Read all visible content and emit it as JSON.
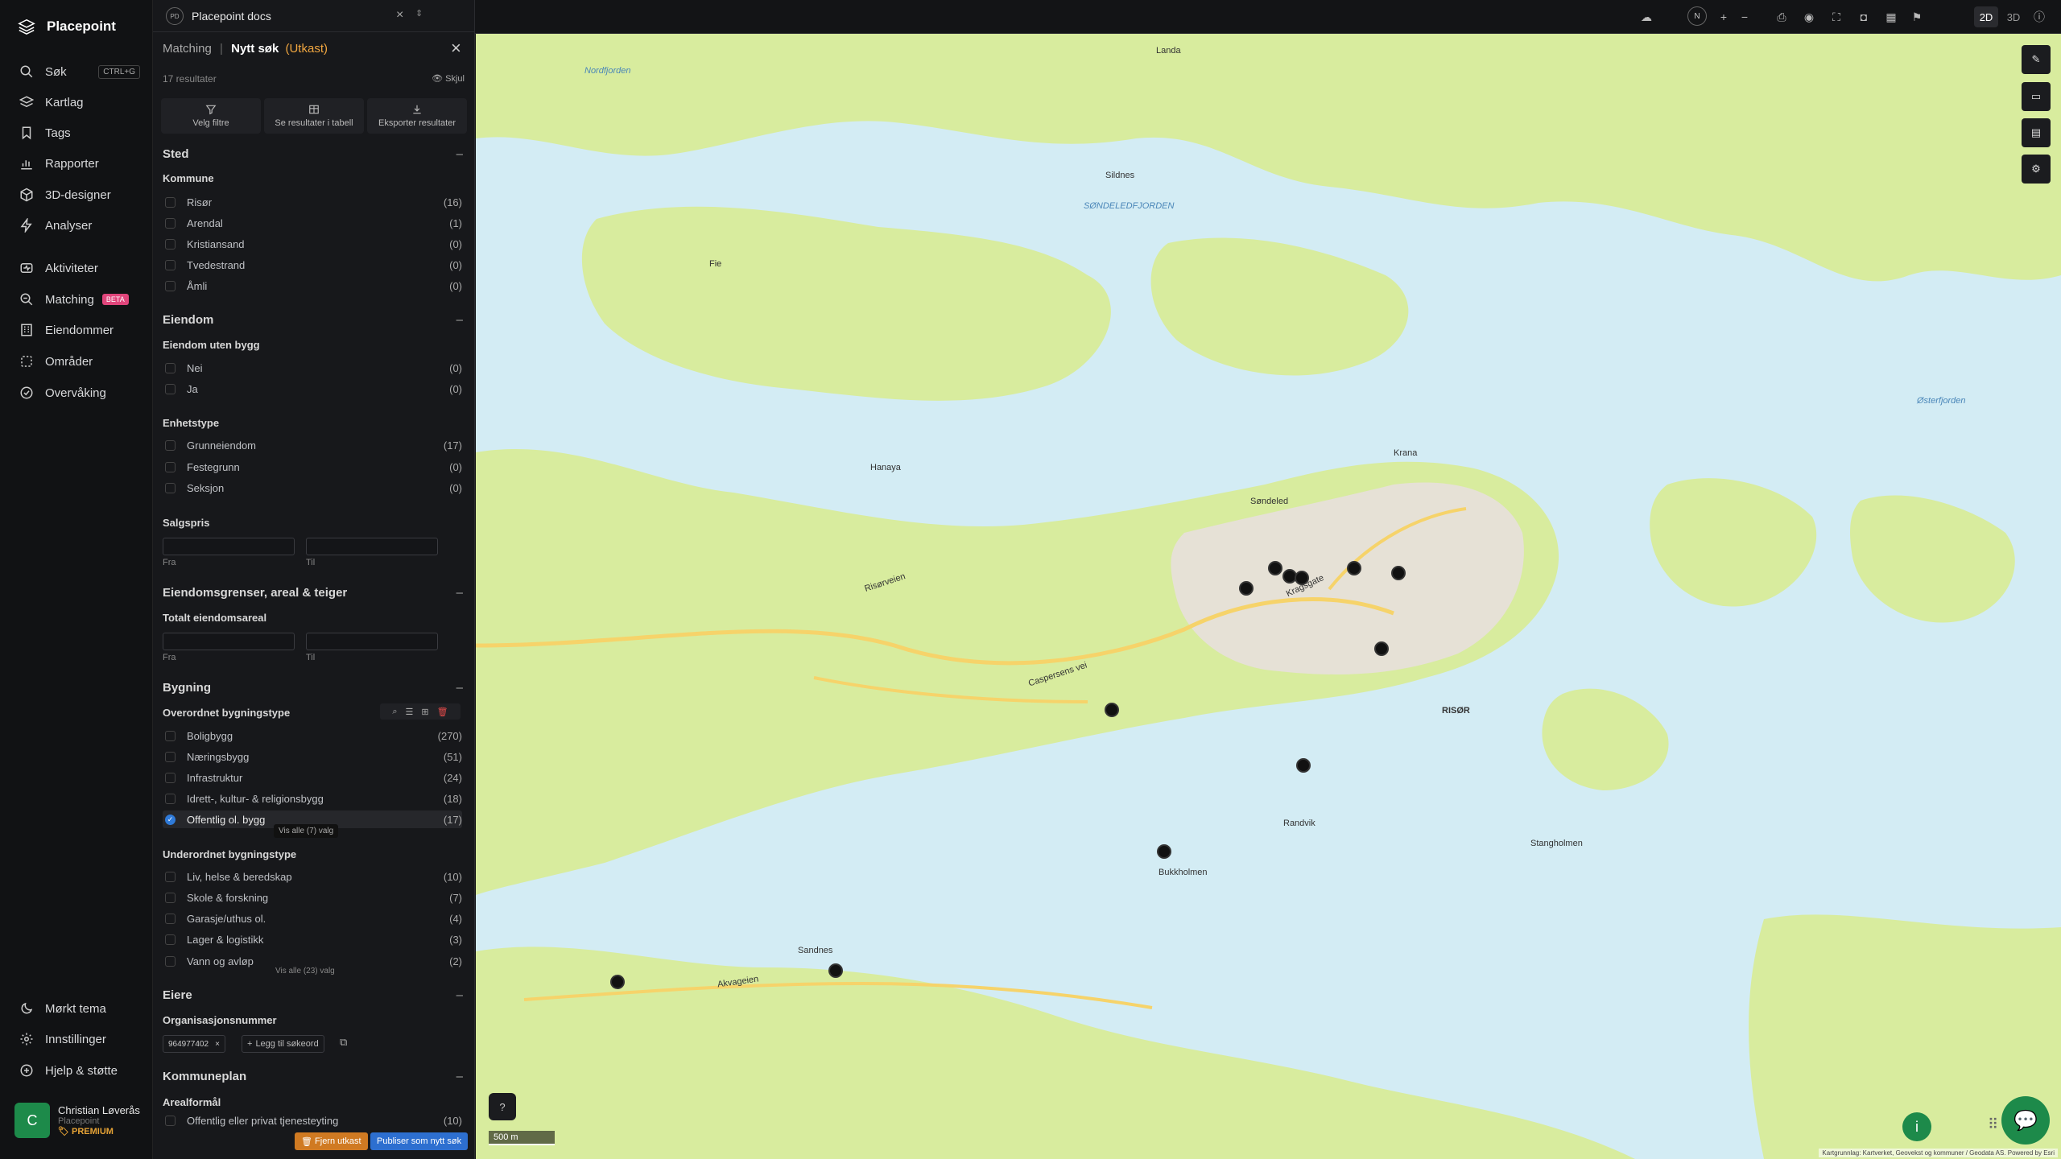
{
  "app": {
    "brand": "Placepoint",
    "nav": [
      {
        "label": "Søk",
        "icon": "search-icon",
        "kbd": "CTRL+G"
      },
      {
        "label": "Kartlag",
        "icon": "layers-icon"
      },
      {
        "label": "Tags",
        "icon": "bookmark-icon"
      },
      {
        "label": "Rapporter",
        "icon": "chart-icon"
      },
      {
        "label": "3D-designer",
        "icon": "cube-icon"
      },
      {
        "label": "Analyser",
        "icon": "bolt-icon"
      },
      {
        "label": "Aktiviteter",
        "icon": "activity-icon"
      },
      {
        "label": "Matching",
        "icon": "matching-icon",
        "badge": "BETA"
      },
      {
        "label": "Eiendommer",
        "icon": "building-icon"
      },
      {
        "label": "Områder",
        "icon": "area-icon"
      },
      {
        "label": "Overvåking",
        "icon": "watch-icon"
      }
    ],
    "bottom_nav": [
      {
        "label": "Mørkt tema",
        "icon": "moon-icon"
      },
      {
        "label": "Innstillinger",
        "icon": "gear-icon"
      },
      {
        "label": "Hjelp & støtte",
        "icon": "help-icon"
      }
    ],
    "user": {
      "initial": "C",
      "name": "Christian Løverås",
      "org": "Placepoint",
      "plan": "PREMIUM"
    }
  },
  "tab": {
    "badge": "PD",
    "title": "Placepoint docs"
  },
  "panel": {
    "crumb_parent": "Matching",
    "crumb_sep": "|",
    "crumb_current": "Nytt søk",
    "crumb_status": "(Utkast)",
    "results": "17 resultater",
    "hide": "Skjul",
    "actions": [
      "Velg filtre",
      "Se resultater i tabell",
      "Eksporter resultater"
    ],
    "sections": {
      "sted": "Sted",
      "kommune": "Kommune",
      "kommune_rows": [
        {
          "label": "Risør",
          "count": "(16)"
        },
        {
          "label": "Arendal",
          "count": "(1)"
        },
        {
          "label": "Kristiansand",
          "count": "(0)"
        },
        {
          "label": "Tvedestrand",
          "count": "(0)"
        },
        {
          "label": "Åmli",
          "count": "(0)"
        }
      ],
      "eiendom": "Eiendom",
      "uten_bygg": "Eiendom uten bygg",
      "uten_bygg_rows": [
        {
          "label": "Nei",
          "count": "(0)"
        },
        {
          "label": "Ja",
          "count": "(0)"
        }
      ],
      "enhetstype": "Enhetstype",
      "enhetstype_rows": [
        {
          "label": "Grunneiendom",
          "count": "(17)"
        },
        {
          "label": "Festegrunn",
          "count": "(0)"
        },
        {
          "label": "Seksjon",
          "count": "(0)"
        }
      ],
      "salgspris": "Salgspris",
      "from": "Fra",
      "to": "Til",
      "grenser": "Eiendomsgrenser, areal & teiger",
      "totalareal": "Totalt eiendomsareal",
      "bygning": "Bygning",
      "overordnet": "Overordnet bygningstype",
      "overordnet_rows": [
        {
          "label": "Boligbygg",
          "count": "(270)"
        },
        {
          "label": "Næringsbygg",
          "count": "(51)"
        },
        {
          "label": "Infrastruktur",
          "count": "(24)"
        },
        {
          "label": "Idrett-, kultur- & religionsbygg",
          "count": "(18)"
        },
        {
          "label": "Offentlig ol. bygg",
          "count": "(17)",
          "checked": true
        }
      ],
      "vis_alle_7": "Vis alle (7) valg",
      "underordnet": "Underordnet bygningstype",
      "underordnet_rows": [
        {
          "label": "Liv, helse & beredskap",
          "count": "(10)"
        },
        {
          "label": "Skole & forskning",
          "count": "(7)"
        },
        {
          "label": "Garasje/uthus ol.",
          "count": "(4)"
        },
        {
          "label": "Lager & logistikk",
          "count": "(3)"
        },
        {
          "label": "Vann og avløp",
          "count": "(2)"
        }
      ],
      "vis_alle_23": "Vis alle (23) valg",
      "eiere": "Eiere",
      "orgnr": "Organisasjonsnummer",
      "orgnr_tag": "964977402",
      "add_keyword": "Legg til søkeord",
      "kommuneplan": "Kommuneplan",
      "arealformal": "Arealformål",
      "arealformal_row": {
        "label": "Offentlig eller privat tjenesteyting",
        "count": "(10)"
      }
    },
    "btn_remove": "Fjern utkast",
    "btn_publish": "Publiser som nytt søk"
  },
  "topbar": {
    "mode_2d": "2D",
    "mode_3d": "3D",
    "compass": "N"
  },
  "map": {
    "scale": "500 m",
    "attribution": "Kartgrunnlag: Kartverket, Geovekst og kommuner / Geodata AS. Powered by Esri",
    "labels": [
      "SØNDELEDFJORDEN",
      "Nordfjorden",
      "Risørveien",
      "Kragsgate",
      "Caspersens vei",
      "RISØR",
      "Akvageien",
      "Sandnes",
      "Fie",
      "Sildnes",
      "Hanaya",
      "Østerfjorden",
      "Landa",
      "Randvik",
      "Bukkholmen",
      "Stangholmen",
      "Søndeled",
      "Kranа"
    ]
  }
}
